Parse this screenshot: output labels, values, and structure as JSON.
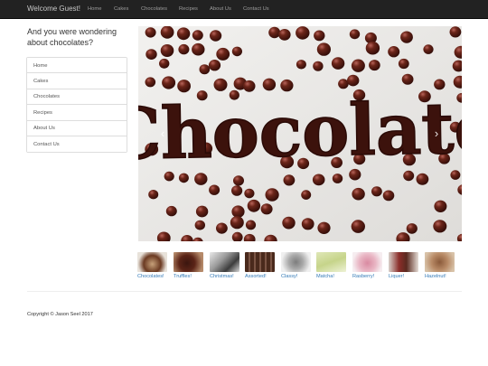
{
  "navbar": {
    "brand": "Welcome Guest!",
    "links": [
      "Home",
      "Cakes",
      "Chocolates",
      "Recipes",
      "About Us",
      "Contact Us"
    ]
  },
  "sidebar": {
    "heading": "And you were wondering about chocolates?",
    "items": [
      "Home",
      "Cakes",
      "Chocolates",
      "Recipes",
      "About Us",
      "Contact Us"
    ]
  },
  "carousel": {
    "slide_text": "Chocolate",
    "prev_icon": "chevron-left-icon",
    "next_icon": "chevron-right-icon"
  },
  "thumbnails": [
    {
      "label": "Chocolates!"
    },
    {
      "label": "Truffles!"
    },
    {
      "label": "Christmas!"
    },
    {
      "label": "Assorted!"
    },
    {
      "label": "Classy!"
    },
    {
      "label": "Matcha!"
    },
    {
      "label": "Rasberry!"
    },
    {
      "label": "Liquer!"
    },
    {
      "label": "Hazelnut!"
    }
  ],
  "footer": {
    "copyright": "Copyright © Jason Seel 2017"
  },
  "colors": {
    "navbar_bg": "#222222",
    "link": "#337ab7",
    "chocolate": "#5a1d14"
  }
}
